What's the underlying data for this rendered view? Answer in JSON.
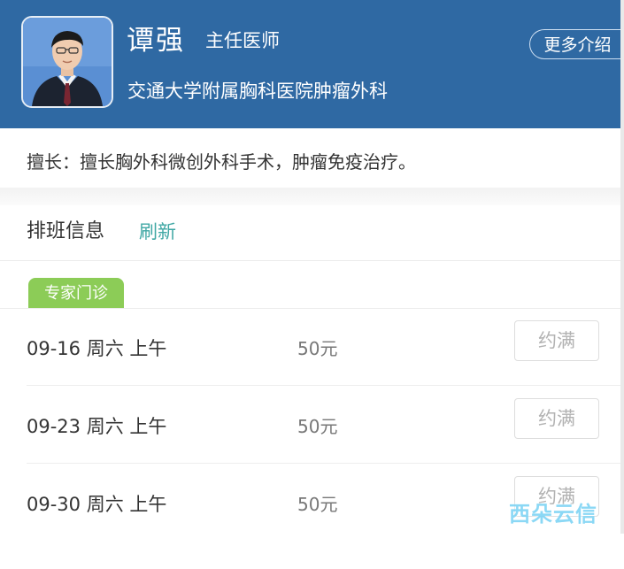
{
  "doctor": {
    "name": "谭强",
    "title": "主任医师",
    "hospital": "交通大学附属胸科医院肿瘤外科",
    "more_label": "更多介绍",
    "avatar_icon": "doctor-portrait"
  },
  "specialty": "擅长：擅长胸外科微创外科手术，肿瘤免疫治疗。",
  "schedule": {
    "title": "排班信息",
    "refresh_label": "刷新",
    "tag": "专家门诊",
    "rows": [
      {
        "date": "09-16 周六 上午",
        "price": "50元",
        "status": "约满"
      },
      {
        "date": "09-23 周六 上午",
        "price": "50元",
        "status": "约满"
      },
      {
        "date": "09-30 周六 上午",
        "price": "50元",
        "status": "约满"
      }
    ]
  },
  "watermark": "西朵云信",
  "colors": {
    "header_bg": "#2f69a3",
    "refresh": "#3fa7a4",
    "tag_bg": "#8ccc57",
    "status_text": "#b2b2b2"
  }
}
